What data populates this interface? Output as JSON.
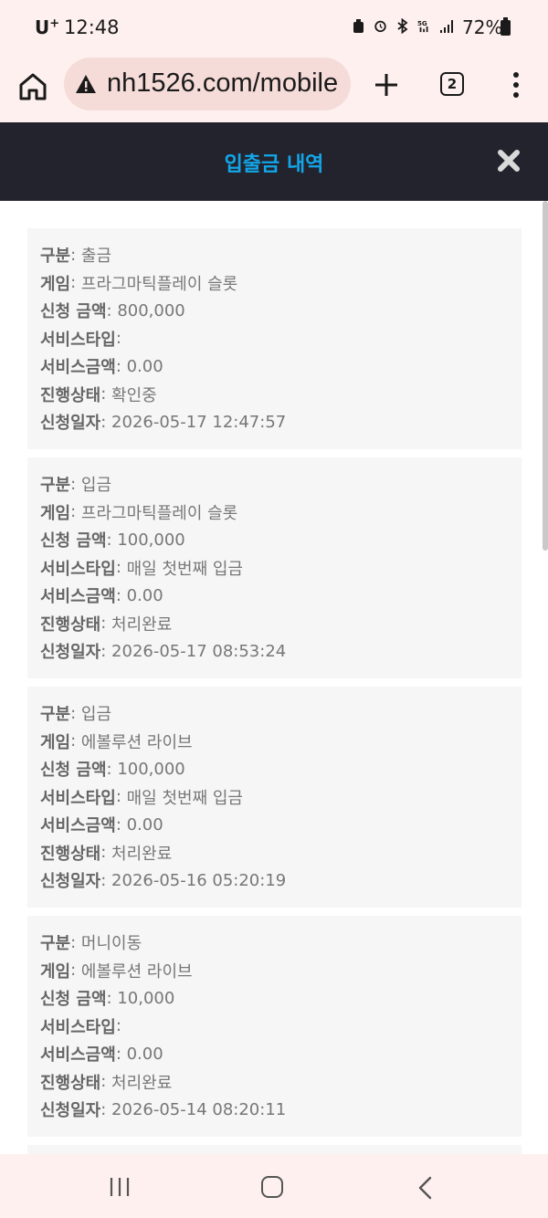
{
  "status_bar": {
    "carrier": "U",
    "carrier_sup": "+",
    "time": "12:48",
    "battery": "72%"
  },
  "browser": {
    "url": "nh1526.com/mobile",
    "tab_count": "2"
  },
  "modal": {
    "title": "입출금 내역"
  },
  "labels": {
    "type": "구분",
    "game": "게임",
    "amount": "신청 금액",
    "service_type": "서비스타입",
    "service_amount": "서비스금액",
    "status": "진행상태",
    "date": "신청일자"
  },
  "records": [
    {
      "type": "출금",
      "game": "프라그마틱플레이 슬롯",
      "amount": "800,000",
      "service_type": "",
      "service_amount": "0.00",
      "status": "확인중",
      "date": "2026-05-17 12:47:57"
    },
    {
      "type": "입금",
      "game": "프라그마틱플레이 슬롯",
      "amount": "100,000",
      "service_type": "매일 첫번째 입금",
      "service_amount": "0.00",
      "status": "처리완료",
      "date": "2026-05-17 08:53:24"
    },
    {
      "type": "입금",
      "game": "에볼루션 라이브",
      "amount": "100,000",
      "service_type": "매일 첫번째 입금",
      "service_amount": "0.00",
      "status": "처리완료",
      "date": "2026-05-16 05:20:19"
    },
    {
      "type": "머니이동",
      "game": "에볼루션 라이브",
      "amount": "10,000",
      "service_type": "",
      "service_amount": "0.00",
      "status": "처리완료",
      "date": "2026-05-14 08:20:11"
    }
  ],
  "icons": {
    "home": "home-icon",
    "warning": "warning-icon",
    "plus": "plus-icon",
    "menu": "more-vert-icon",
    "close": "close-icon"
  },
  "colors": {
    "header_bg": "#23232e",
    "title_accent": "#12a6e8",
    "card_bg": "#f6f6f6",
    "chrome_bg": "#fdf0ee"
  }
}
